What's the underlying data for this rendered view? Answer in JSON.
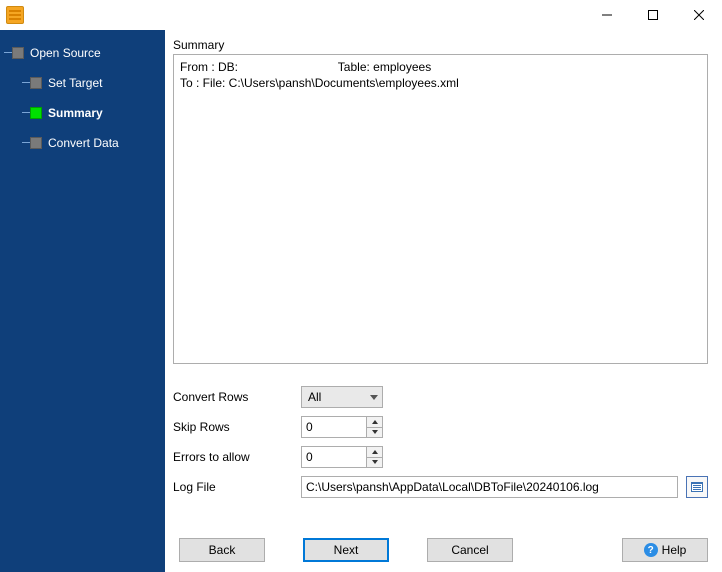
{
  "sidebar": {
    "items": [
      {
        "label": "Open Source"
      },
      {
        "label": "Set Target"
      },
      {
        "label": "Summary"
      },
      {
        "label": "Convert Data"
      }
    ]
  },
  "summary": {
    "title": "Summary",
    "line1": "From : DB:                              Table: employees",
    "line2": "To : File: C:\\Users\\pansh\\Documents\\employees.xml"
  },
  "controls": {
    "convert_rows_label": "Convert Rows",
    "convert_rows_value": "All",
    "skip_rows_label": "Skip Rows",
    "skip_rows_value": "0",
    "errors_label": "Errors to allow",
    "errors_value": "0",
    "log_label": "Log File",
    "log_value": "C:\\Users\\pansh\\AppData\\Local\\DBToFile\\20240106.log"
  },
  "buttons": {
    "back": "Back",
    "next": "Next",
    "cancel": "Cancel",
    "help": "Help"
  }
}
